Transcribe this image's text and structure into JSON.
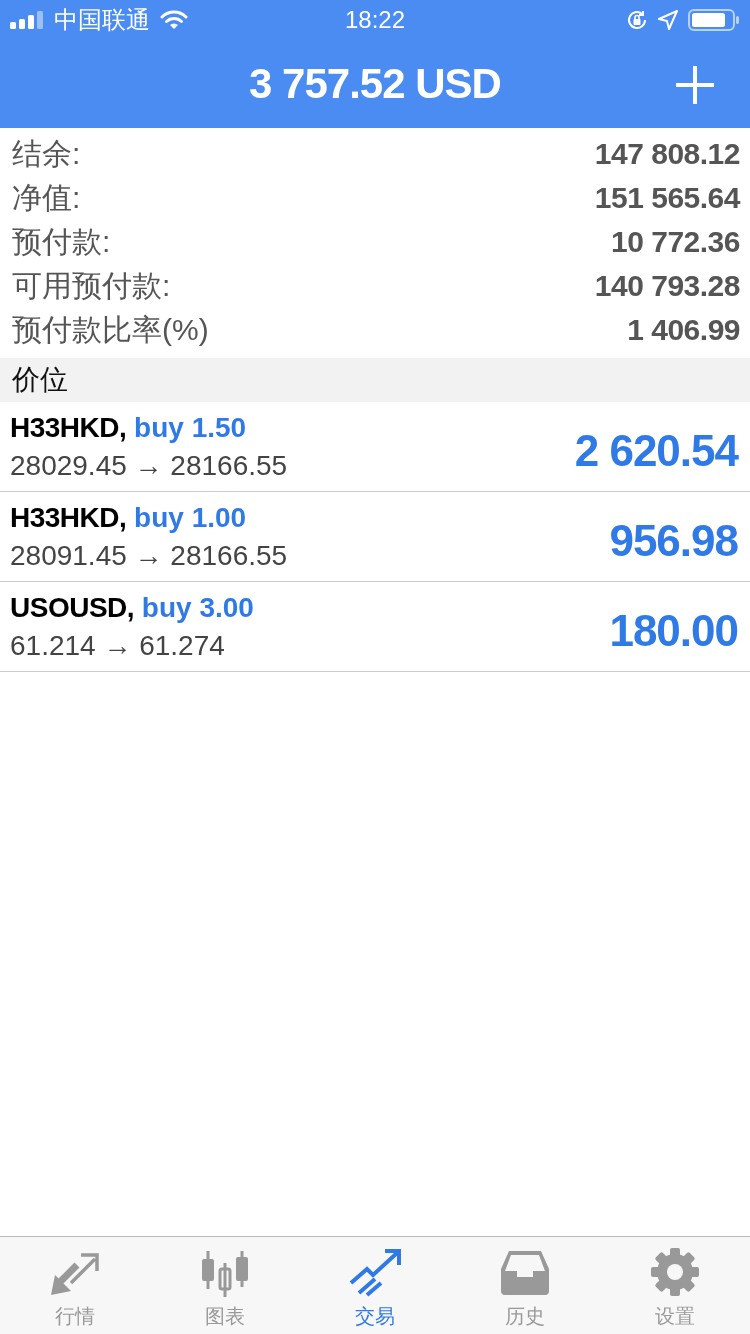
{
  "status_bar": {
    "carrier": "中国联通",
    "time": "18:22"
  },
  "header": {
    "title": "3 757.52 USD"
  },
  "summary": [
    {
      "label": "结余:",
      "value": "147 808.12"
    },
    {
      "label": "净值:",
      "value": "151 565.64"
    },
    {
      "label": "预付款:",
      "value": "10 772.36"
    },
    {
      "label": "可用预付款:",
      "value": "140 793.28"
    },
    {
      "label": "预付款比率(%)",
      "value": "1 406.99"
    }
  ],
  "section": {
    "title": "价位"
  },
  "positions": [
    {
      "symbol": "H33HKD,",
      "order": "buy 1.50",
      "prices": "28029.45 → 28166.55",
      "profit": "2 620.54"
    },
    {
      "symbol": "H33HKD,",
      "order": "buy 1.00",
      "prices": "28091.45 → 28166.55",
      "profit": "956.98"
    },
    {
      "symbol": "USOUSD,",
      "order": "buy 3.00",
      "prices": "61.214 → 61.274",
      "profit": "180.00"
    }
  ],
  "tabs": [
    {
      "kind": "quotes",
      "label": "行情",
      "selected": false
    },
    {
      "kind": "chart",
      "label": "图表",
      "selected": false
    },
    {
      "kind": "trade",
      "label": "交易",
      "selected": true
    },
    {
      "kind": "history",
      "label": "历史",
      "selected": false
    },
    {
      "kind": "settings",
      "label": "设置",
      "selected": false
    }
  ]
}
